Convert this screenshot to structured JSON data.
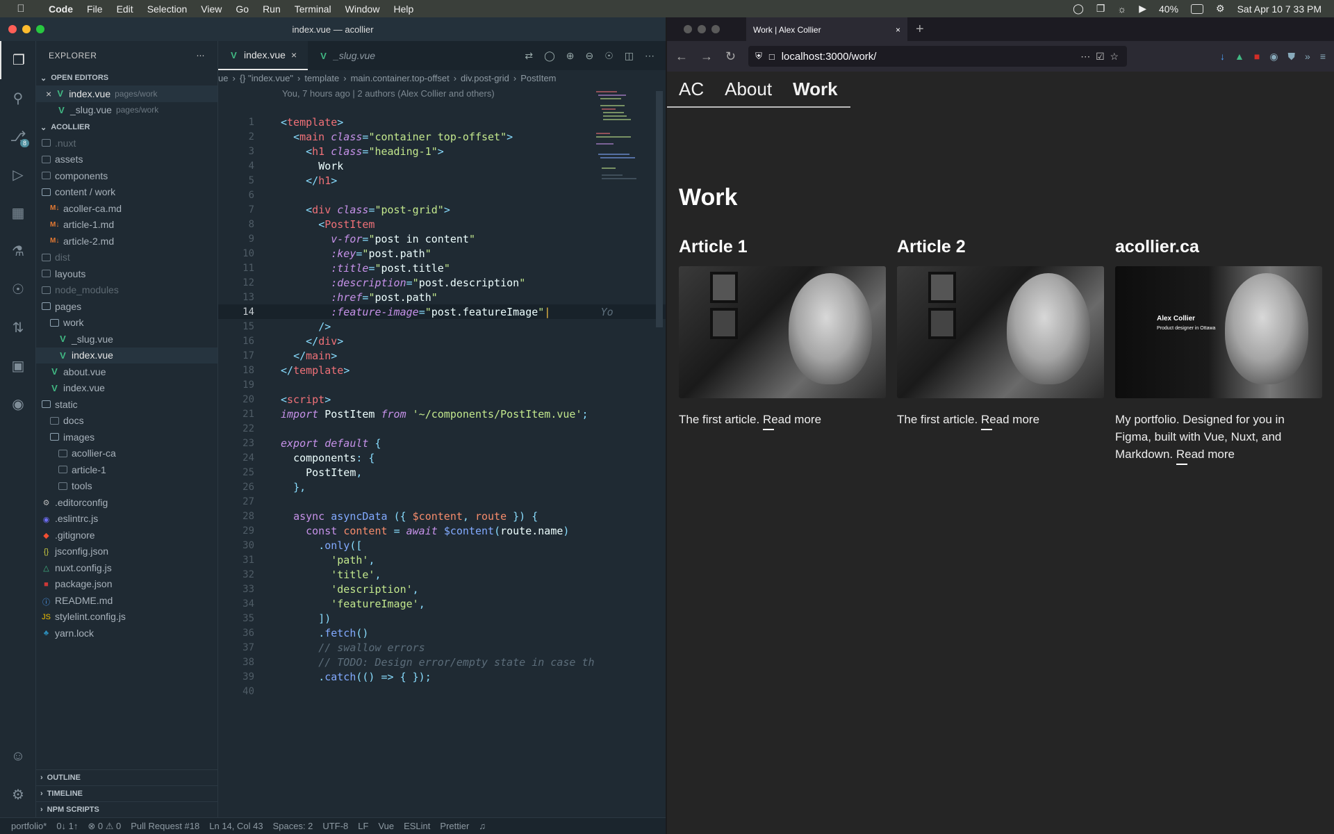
{
  "menubar": {
    "app": "Code",
    "items": [
      "File",
      "Edit",
      "Selection",
      "View",
      "Go",
      "Run",
      "Terminal",
      "Window",
      "Help"
    ],
    "battery": "40%",
    "datetime": "Sat Apr 10  7 33 PM"
  },
  "vscode": {
    "title": "index.vue — acollier",
    "scm_badge": "8",
    "explorer_title": "EXPLORER",
    "open_editors_title": "OPEN EDITORS",
    "open_editors": [
      {
        "name": "index.vue",
        "path": "pages/work",
        "close": "×"
      },
      {
        "name": "_slug.vue",
        "path": "pages/work"
      }
    ],
    "project_title": "ACOLLIER",
    "tree": [
      {
        "label": ".nuxt",
        "indent": 0,
        "icon": "folder",
        "dim": true
      },
      {
        "label": "assets",
        "indent": 0,
        "icon": "folder"
      },
      {
        "label": "components",
        "indent": 0,
        "icon": "folder"
      },
      {
        "label": "content / work",
        "indent": 0,
        "icon": "folder-open"
      },
      {
        "label": "acoller-ca.md",
        "indent": 1,
        "icon": "md"
      },
      {
        "label": "article-1.md",
        "indent": 1,
        "icon": "md"
      },
      {
        "label": "article-2.md",
        "indent": 1,
        "icon": "md"
      },
      {
        "label": "dist",
        "indent": 0,
        "icon": "folder",
        "dim": true
      },
      {
        "label": "layouts",
        "indent": 0,
        "icon": "folder"
      },
      {
        "label": "node_modules",
        "indent": 0,
        "icon": "folder",
        "dim": true
      },
      {
        "label": "pages",
        "indent": 0,
        "icon": "folder-open"
      },
      {
        "label": "work",
        "indent": 1,
        "icon": "folder-open"
      },
      {
        "label": "_slug.vue",
        "indent": 2,
        "icon": "vue"
      },
      {
        "label": "index.vue",
        "indent": 2,
        "icon": "vue",
        "selected": true
      },
      {
        "label": "about.vue",
        "indent": 1,
        "icon": "vue"
      },
      {
        "label": "index.vue",
        "indent": 1,
        "icon": "vue"
      },
      {
        "label": "static",
        "indent": 0,
        "icon": "folder-open"
      },
      {
        "label": "docs",
        "indent": 1,
        "icon": "folder"
      },
      {
        "label": "images",
        "indent": 1,
        "icon": "folder-open"
      },
      {
        "label": "acollier-ca",
        "indent": 2,
        "icon": "folder"
      },
      {
        "label": "article-1",
        "indent": 2,
        "icon": "folder"
      },
      {
        "label": "tools",
        "indent": 2,
        "icon": "folder"
      },
      {
        "label": ".editorconfig",
        "indent": 0,
        "icon": "gear"
      },
      {
        "label": ".eslintrc.js",
        "indent": 0,
        "icon": "eslint"
      },
      {
        "label": ".gitignore",
        "indent": 0,
        "icon": "git"
      },
      {
        "label": "jsconfig.json",
        "indent": 0,
        "icon": "json"
      },
      {
        "label": "nuxt.config.js",
        "indent": 0,
        "icon": "nuxt"
      },
      {
        "label": "package.json",
        "indent": 0,
        "icon": "npm"
      },
      {
        "label": "README.md",
        "indent": 0,
        "icon": "info"
      },
      {
        "label": "stylelint.config.js",
        "indent": 0,
        "icon": "js"
      },
      {
        "label": "yarn.lock",
        "indent": 0,
        "icon": "yarn"
      }
    ],
    "outline_title": "OUTLINE",
    "timeline_title": "TIMELINE",
    "npm_title": "NPM SCRIPTS",
    "tabs": [
      {
        "label": "index.vue",
        "close": "×",
        "active": true
      },
      {
        "label": "_slug.vue",
        "active": false
      }
    ],
    "breadcrumbs": [
      "ue",
      "{} \"index.vue\"",
      "template",
      "main.container.top-offset",
      "div.post-grid",
      "PostItem"
    ],
    "blame": "You, 7 hours ago | 2 authors (Alex Collier and others)",
    "current_line": 14,
    "inline_blame": "Yo",
    "status": {
      "branch": "portfolio*",
      "sync": "0↓ 1↑",
      "problems": "⊗ 0 ⚠ 0",
      "pr": "Pull Request #18",
      "position": "Ln 14, Col 43",
      "spaces": "Spaces: 2",
      "encoding": "UTF-8",
      "eol": "LF",
      "language": "Vue",
      "eslint": "ESLint",
      "prettier": "Prettier"
    }
  },
  "browser": {
    "tab_title": "Work | Alex Collier",
    "tab_close": "×",
    "url": "localhost:3000/work/",
    "site_nav": [
      "AC",
      "About",
      "Work"
    ],
    "heading": "Work",
    "cards": [
      {
        "title": "Article 1",
        "desc": "The first article.",
        "read_more": "Read more"
      },
      {
        "title": "Article 2",
        "desc": "The first article.",
        "read_more": "Read more"
      },
      {
        "title": "acollier.ca",
        "desc": "My portfolio. Designed for you in Figma, built with Vue, Nuxt, and Markdown.",
        "read_more": "Read more",
        "thumb_text": "Alex Collier",
        "thumb_sub": "Product designer in Ottawa"
      }
    ]
  }
}
